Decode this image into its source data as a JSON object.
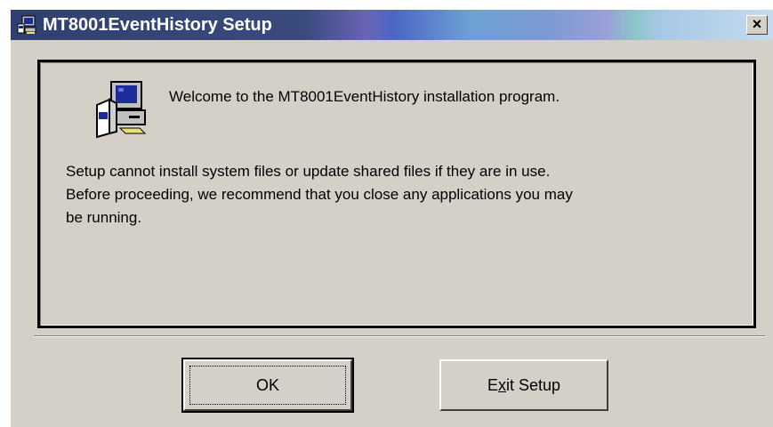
{
  "window": {
    "title": "MT8001EventHistory Setup",
    "close_symbol": "×"
  },
  "icons": {
    "title": "setup-computer-icon",
    "welcome": "setup-computer-icon"
  },
  "content": {
    "welcome": "Welcome to the MT8001EventHistory installation program.",
    "message": "Setup cannot install system files or update shared files if they are in use.\nBefore proceeding, we recommend that you close any applications you may\nbe running."
  },
  "buttons": {
    "ok_label": "OK",
    "exit_label_pre": "E",
    "exit_label_mnemonic": "x",
    "exit_label_post": "it Setup"
  }
}
